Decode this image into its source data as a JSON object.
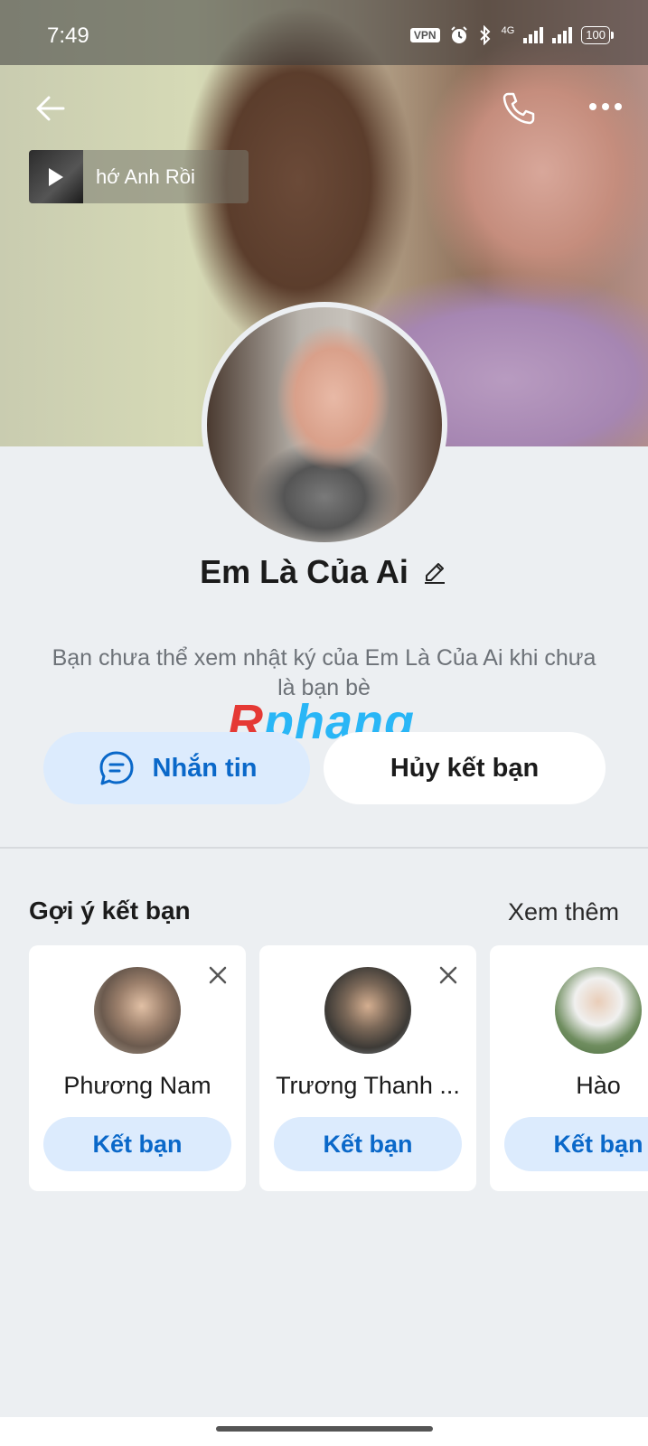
{
  "status_bar": {
    "time": "7:49",
    "vpn": "VPN",
    "network": "4G",
    "battery": "100"
  },
  "music": {
    "title": "hớ Anh Rồi"
  },
  "profile": {
    "name": "Em Là Của Ai",
    "notice": "Bạn chưa thể xem nhật ký của Em Là Của Ai khi chưa là bạn bè"
  },
  "watermark": {
    "first": "R",
    "rest": "phang"
  },
  "actions": {
    "message_label": "Nhắn tin",
    "unfriend_label": "Hủy kết bạn"
  },
  "suggestions": {
    "title": "Gợi ý kết bạn",
    "see_more": "Xem thêm",
    "items": [
      {
        "name": "Phương Nam",
        "button": "Kết bạn"
      },
      {
        "name": "Trương Thanh ...",
        "button": "Kết bạn"
      },
      {
        "name": "Hào",
        "button": "Kết bạn"
      }
    ]
  },
  "colors": {
    "accent": "#0a68c9",
    "accent_bg": "#dcebfd",
    "page_bg": "#eceff2"
  }
}
